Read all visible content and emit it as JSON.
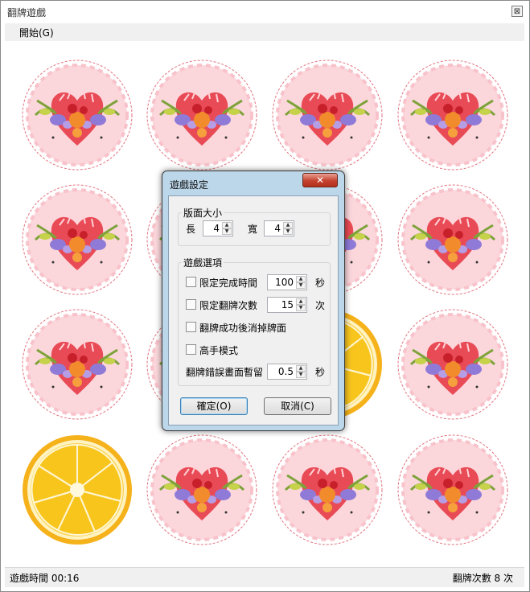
{
  "window": {
    "title": "翻牌遊戲",
    "close_glyph": "⊠"
  },
  "menu": {
    "start": "開始(G)"
  },
  "status": {
    "left": "遊戲時間 00:16",
    "right": "翻牌次數 8 次"
  },
  "board": {
    "cards": [
      "heart",
      "heart",
      "heart",
      "heart",
      "heart",
      "heart",
      "heart",
      "heart",
      "heart",
      "heart",
      "lemon",
      "heart",
      "lemon",
      "heart",
      "heart",
      "heart"
    ]
  },
  "dialog": {
    "title": "遊戲設定",
    "close_glyph": "✕",
    "board_size": {
      "legend": "版面大小",
      "length_label": "長",
      "length_value": "4",
      "width_label": "寬",
      "width_value": "4"
    },
    "options": {
      "legend": "遊戲選項",
      "time_limit_label": "限定完成時間",
      "time_limit_value": "100",
      "time_limit_unit": "秒",
      "time_limit_checked": false,
      "flip_limit_label": "限定翻牌次數",
      "flip_limit_value": "15",
      "flip_limit_unit": "次",
      "flip_limit_checked": false,
      "remove_label": "翻牌成功後消掉牌面",
      "remove_checked": false,
      "expert_label": "高手模式",
      "expert_checked": false,
      "pause_label": "翻牌錯誤畫面暫留",
      "pause_value": "0.5",
      "pause_unit": "秒"
    },
    "ok_label": "確定(O)",
    "cancel_label": "取消(C)"
  },
  "colors": {
    "dialog_frame": "#bcd6ea",
    "close_red": "#c5412e",
    "card_pink": "#fbd7dc",
    "card_border": "#e2737f",
    "lemon": "#f6b21b"
  }
}
